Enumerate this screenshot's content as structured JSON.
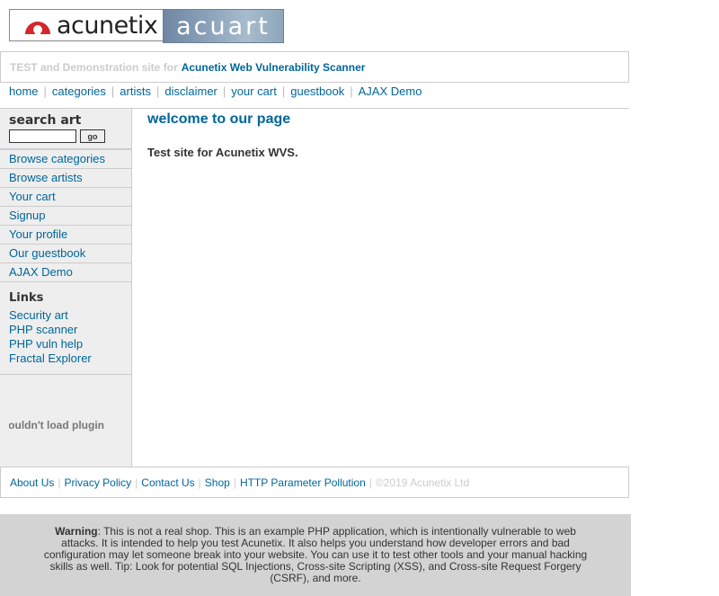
{
  "header": {
    "logo_left": "acunetix",
    "logo_right": "acuart",
    "tagline_prefix": "TEST and Demonstration site for",
    "tagline_link": "Acunetix Web Vulnerability Scanner"
  },
  "topnav": [
    "home",
    "categories",
    "artists",
    "disclaimer",
    "your cart",
    "guestbook",
    "AJAX Demo"
  ],
  "sidebar": {
    "search_title": "search art",
    "search_value": "",
    "search_button": "go",
    "menu": [
      "Browse categories",
      "Browse artists",
      "Your cart",
      "Signup",
      "Your profile",
      "Our guestbook",
      "AJAX Demo"
    ],
    "links_title": "Links",
    "links": [
      "Security art",
      "PHP scanner",
      "PHP vuln help",
      "Fractal Explorer"
    ],
    "plugin_message": "Couldn't load plugin"
  },
  "main": {
    "title": "welcome to our page",
    "text": "Test site for Acunetix WVS."
  },
  "footer": {
    "links": [
      "About Us",
      "Privacy Policy",
      "Contact Us",
      "Shop",
      "HTTP Parameter Pollution"
    ],
    "copyright": "©2019 Acunetix Ltd"
  },
  "warning": {
    "label": "Warning",
    "text": ": This is not a real shop. This is an example PHP application, which is intentionally vulnerable to web attacks. It is intended to help you test Acunetix. It also helps you understand how developer errors and bad configuration may let someone break into your website. You can use it to test other tools and your manual hacking skills as well. Tip: Look for potential SQL Injections, Cross-site Scripting (XSS), and Cross-site Request Forgery (CSRF), and more."
  },
  "colors": {
    "link": "#006699",
    "sidebar_bg": "#eeeeee",
    "warning_bg": "#d3d3d3",
    "logo_mark": "#d4262b"
  }
}
